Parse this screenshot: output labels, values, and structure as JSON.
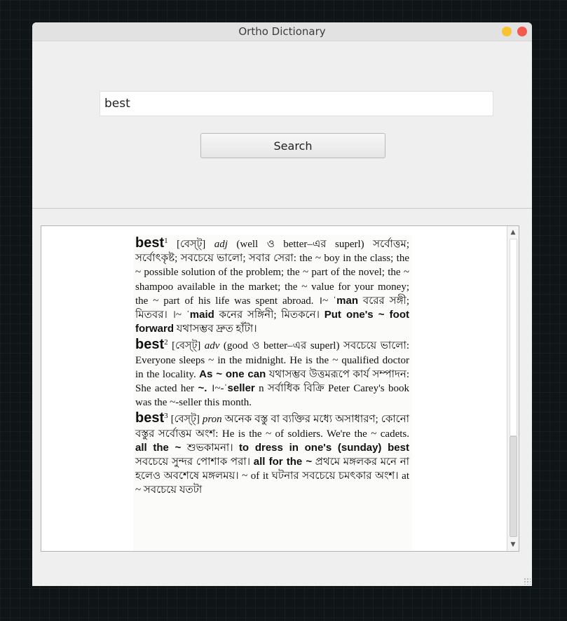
{
  "window": {
    "title": "Ortho Dictionary"
  },
  "search": {
    "value": "best",
    "button_label": "Search"
  },
  "result": {
    "entries": [
      {
        "headword": "best",
        "sup": "1",
        "pron": "[বেস্‌ট্‌]",
        "pos": "adj",
        "text": " (well ও better–এর superl) সর্বোত্তম; সর্বোৎকৃষ্ট; সবচেয়ে ভালো; সবার সেরা: the ~ boy in the class; the ~ possible solution of the problem; the ~ part of the novel; the ~ shampoo available in the market; the ~ value for your money; the ~ part of his life was spent abroad. ।~ ˈ",
        "b1": "man",
        "t1": " বরের সঙ্গী; মিতবর। ।~ ˈ",
        "b2": "maid",
        "t2": " কনের সঙ্গিনী; মিতকনে। ",
        "b3": "Put one's ~ foot forward",
        "t3": " যথাসম্ভব দ্রুত হাঁটা।"
      },
      {
        "headword": "best",
        "sup": "2",
        "pron": "[বেস্‌ট্‌]",
        "pos": "adv",
        "text": " (good ও better–এর superl) সবচেয়ে ভালো: Everyone sleeps ~ in the midnight. He is the ~ qualified doctor in the locality. ",
        "b1": "As ~ one can",
        "t1": " যথাসম্ভব উত্তমরূপে কার্য সম্পাদন: She acted her ",
        "b2": "~.",
        "t2": " ।~-ˈ",
        "b3": "seller",
        "t3": " n সর্বাধিক বিক্রি Peter Carey's book was the ~-seller this month."
      },
      {
        "headword": "best",
        "sup": "3",
        "pron": "[বেস্‌ট্‌]",
        "pos": "pron",
        "text": " অনেক বস্তু বা ব্যক্তির মধ্যে অসাধারণ; কোনো বস্তুর সর্বোত্তম অংশ: He is the ~ of soldiers. We're the ~ cadets. ",
        "b1": "all the ~",
        "t1": " শুভকামনা। ",
        "b2": "to dress in one's (sunday) best",
        "t2": " সবচেয়ে সুন্দর পোশাক পরা। ",
        "b3": "all for the ~",
        "t3": " প্রথমে মঙ্গলকর মনে না হলেও অবশেষে মঙ্গলময়। ~ of it ঘটনার সবচেয়ে চমৎকার অংশ। at ~ সবচেয়ে যতটা"
      }
    ]
  },
  "scrollbar": {
    "up_icon": "arrow-up-icon",
    "down_icon": "arrow-down-icon"
  }
}
